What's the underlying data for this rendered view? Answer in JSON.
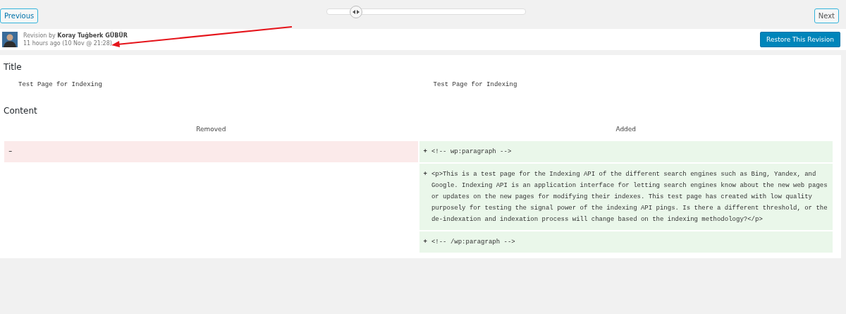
{
  "nav": {
    "previous": "Previous",
    "next": "Next",
    "slider": {
      "level": 0.15
    }
  },
  "revision": {
    "by_label": "Revision by",
    "author": "Koray Tuğberk GÜBÜR",
    "time": "11 hours ago",
    "date": "(10 Nov @ 21:28)",
    "restore": "Restore This Revision"
  },
  "sections": [
    {
      "heading": "Title",
      "rows": [
        [
          {
            "kind": "context",
            "text": "Test Page for Indexing"
          },
          {
            "kind": "context",
            "text": "Test Page for Indexing"
          }
        ]
      ]
    },
    {
      "heading": "Content",
      "columns": [
        "Removed",
        "Added"
      ],
      "rows": [
        [
          {
            "kind": "removed",
            "sign": "–"
          },
          {
            "kind": "added",
            "sign": "+",
            "text": "<!-- wp:paragraph -->"
          }
        ],
        [
          {
            "kind": "empty"
          },
          {
            "kind": "added",
            "sign": "+",
            "text": "<p>This is a test page for the Indexing API of the different search engines such as Bing, Yandex, and Google. Indexing API is an application interface for letting search engines know about the new web pages or updates on the new pages for modifying their indexes. This test page has created with low quality purposely for testing the signal power of the indexing API pings. Is there a different threshold, or the de-indexation and indexation process will change based on the indexing methodology?</p>"
          }
        ],
        [
          {
            "kind": "empty"
          },
          {
            "kind": "added",
            "sign": "+",
            "text": "<!-- /wp:paragraph -->"
          }
        ]
      ]
    }
  ]
}
